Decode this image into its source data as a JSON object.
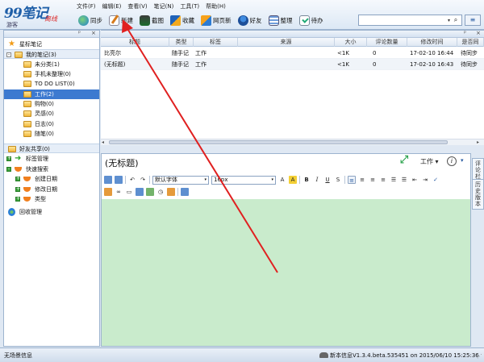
{
  "app": {
    "logo": "99笔记",
    "offline": "离线",
    "user": "游客"
  },
  "menu": [
    "文件(F)",
    "编辑(E)",
    "查看(V)",
    "笔记(N)",
    "工具(T)",
    "帮助(H)"
  ],
  "toolbar": [
    {
      "label": "同步",
      "icon": "sync-icon"
    },
    {
      "label": "新建",
      "icon": "new-note-icon"
    },
    {
      "label": "截图",
      "icon": "screenshot-icon"
    },
    {
      "label": "收藏",
      "icon": "favorite-icon"
    },
    {
      "label": "网页新",
      "icon": "web-clip-icon"
    },
    {
      "label": "好友",
      "icon": "friends-icon"
    },
    {
      "label": "整理",
      "icon": "organize-icon"
    },
    {
      "label": "待办",
      "icon": "todo-icon"
    }
  ],
  "search": {
    "value": "",
    "dropdown": "▾",
    "button": "⌕"
  },
  "listview_button": "≡",
  "panel_controls": {
    "pin": "ᵖ",
    "close": "×"
  },
  "tree": [
    {
      "label": "星标笔记",
      "level": 0,
      "icon": "star-icon"
    },
    {
      "label": "我的笔记(3)",
      "level": 0,
      "icon": "folder-icon",
      "expander": "-",
      "group": true
    },
    {
      "label": "未分类(1)",
      "level": 1,
      "icon": "folder-icon"
    },
    {
      "label": "手机未整理(0)",
      "level": 1,
      "icon": "folder-icon"
    },
    {
      "label": "TO DO LIST(0)",
      "level": 1,
      "icon": "folder-icon"
    },
    {
      "label": "工作(2)",
      "level": 1,
      "icon": "folder-icon",
      "selected": true
    },
    {
      "label": "购物(0)",
      "level": 1,
      "icon": "folder-icon"
    },
    {
      "label": "灵感(0)",
      "level": 1,
      "icon": "folder-icon"
    },
    {
      "label": "日志(0)",
      "level": 1,
      "icon": "folder-icon"
    },
    {
      "label": "随笔(0)",
      "level": 1,
      "icon": "folder-icon"
    },
    {
      "label": "好友共享(0)",
      "level": 0,
      "icon": "folder-icon",
      "group": true
    },
    {
      "label": "标签管理",
      "level": 0,
      "icon": "tag-arrow-icon",
      "expander": "+"
    },
    {
      "label": "快速搜索",
      "level": 0,
      "icon": "search-bowl-icon",
      "expander": "-"
    },
    {
      "label": "创建日期",
      "level": 1,
      "icon": "search-bowl-icon",
      "expander": "+"
    },
    {
      "label": "修改日期",
      "level": 1,
      "icon": "search-bowl-icon",
      "expander": "+"
    },
    {
      "label": "类型",
      "level": 1,
      "icon": "search-bowl-icon",
      "expander": "+"
    },
    {
      "label": "回收管理",
      "level": 0,
      "icon": "recycle-icon"
    }
  ],
  "list": {
    "columns": [
      "标题",
      "类型",
      "标签",
      "来源",
      "大小",
      "评论数量",
      "修改时间",
      "是否同"
    ],
    "rows": [
      {
        "title": "比亮尔",
        "type": "随手记",
        "tag": "工作",
        "source": "",
        "size": "<1K",
        "comments": "0",
        "modified": "17-02-10 16:44",
        "sync": "待同步"
      },
      {
        "title": "(无标题)",
        "type": "随手记",
        "tag": "工作",
        "source": "",
        "size": "<1K",
        "comments": "0",
        "modified": "17-02-10 16:43",
        "sync": "待同步"
      }
    ]
  },
  "editor": {
    "title": "(无标题)",
    "category": "工作 ▾",
    "font": "默认字体",
    "size": "16px",
    "more": "▾"
  },
  "sidetabs": [
    "评论栏",
    "历史版本"
  ],
  "status": {
    "left": "无场景信息",
    "right": "新本信息V1.3.4.beta.535451 on 2015/06/10 15:25:36"
  },
  "colors": {
    "accent": "#3d7ad0",
    "editor_bg": "#c9ebcc",
    "arrow": "#e02020"
  }
}
